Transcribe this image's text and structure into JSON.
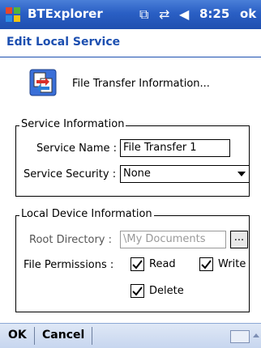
{
  "titlebar": {
    "app_title": "BTExplorer",
    "time": "8:25",
    "ok_label": "ok",
    "icons": [
      "windows-flag-icon",
      "sync-icon",
      "connectivity-icon",
      "volume-icon"
    ]
  },
  "header": {
    "title": "Edit Local Service"
  },
  "service": {
    "title": "File Transfer Information...",
    "icon": "file-transfer-icon"
  },
  "service_info": {
    "group_label": "Service Information",
    "name_label": "Service Name :",
    "name_value": "File Transfer 1",
    "security_label": "Service Security :",
    "security_value": "None"
  },
  "local_device": {
    "group_label": "Local Device Information",
    "root_label": "Root Directory :",
    "root_value": "\\My Documents",
    "browse_label": "...",
    "permissions_label": "File Permissions :",
    "permissions": {
      "read": "Read",
      "write": "Write",
      "delete": "Delete"
    },
    "checked": {
      "read": true,
      "write": true,
      "delete": true
    }
  },
  "menubar": {
    "ok": "OK",
    "cancel": "Cancel"
  },
  "colors": {
    "titlebar": "#2a5fc4",
    "header_text": "#1c4fb0",
    "menubar": "#d3e0f3"
  }
}
